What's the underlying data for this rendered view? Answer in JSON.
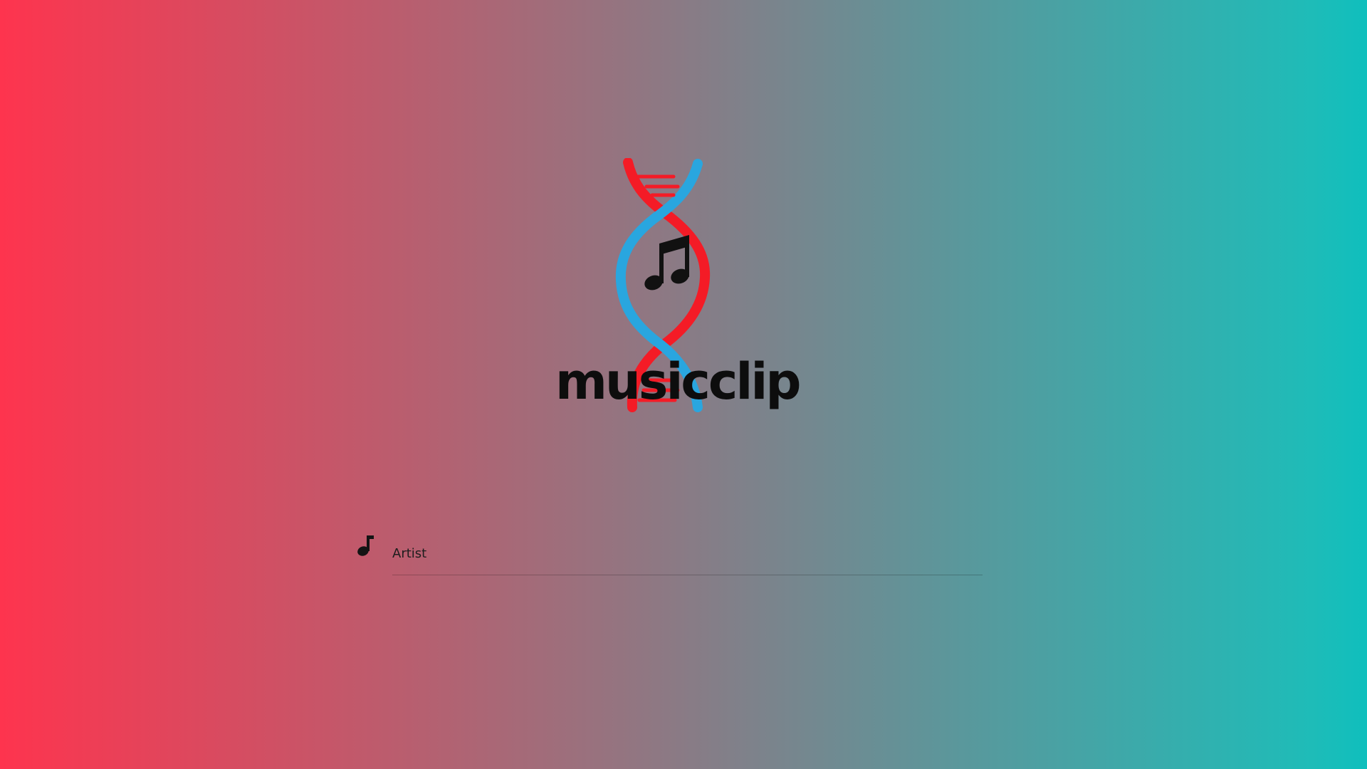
{
  "app": {
    "logo_text": "musicclip",
    "logo_icon": "dna-helix-music-note-icon"
  },
  "search": {
    "icon": "music-note-icon",
    "label": "Artist",
    "value": ""
  },
  "colors": {
    "background_left": "#fe344e",
    "background_right": "#0fbfbd",
    "helix_red": "#f41b26",
    "helix_blue": "#29a6df",
    "text_dark": "#0d0d0d"
  }
}
